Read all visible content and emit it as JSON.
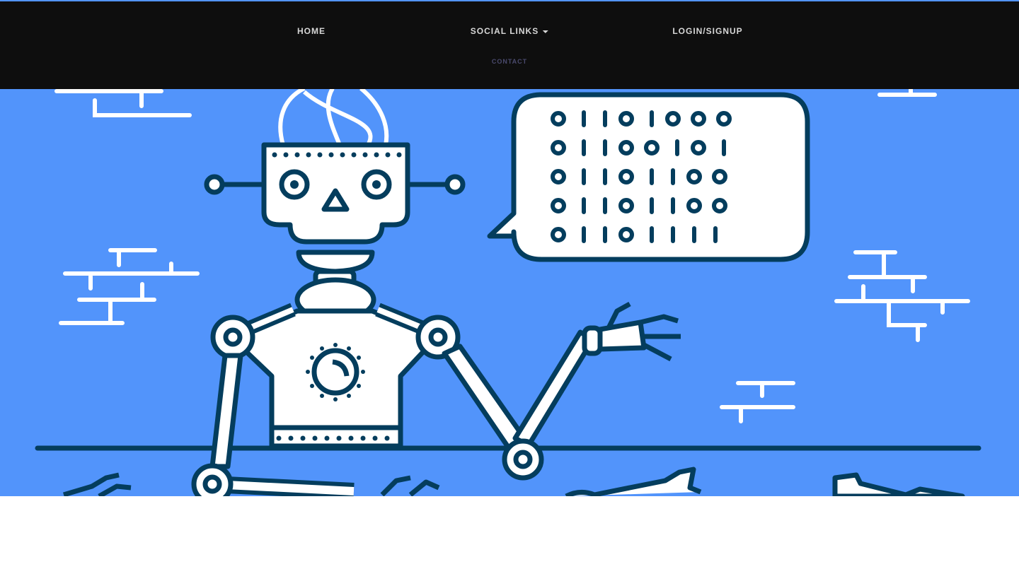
{
  "nav": {
    "home": "HOME",
    "social": "SOCIAL LINKS",
    "login": "LOGIN/SIGNUP",
    "contact": "CONTACT"
  },
  "hero": {
    "bubble_rows": [
      "o||oIooo",
      "o||oo|o|",
      "o||o||oo",
      "o||o||oo",
      "o||o||||"
    ]
  },
  "colors": {
    "nav_bg": "#0e0e0e",
    "hero_bg": "#5294fb",
    "outline": "#043d5d"
  }
}
